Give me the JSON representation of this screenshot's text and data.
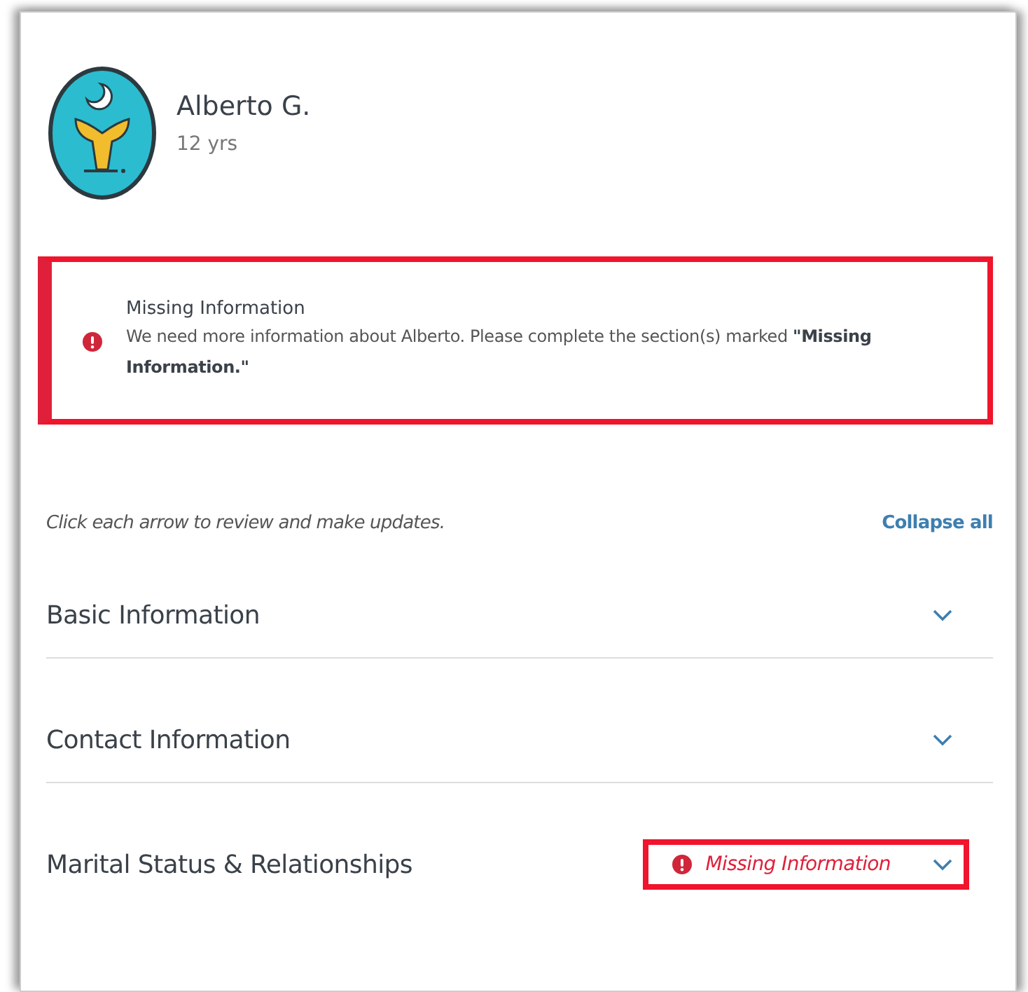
{
  "profile": {
    "name": "Alberto G.",
    "age": "12 yrs"
  },
  "alert": {
    "title": "Missing Information",
    "message": "We need more information about Alberto. Please complete the section(s) marked **\"Missing Information.\"**",
    "highlighted": true
  },
  "instructions": "Click each arrow to review and make updates.",
  "collapse_link": "Collapse all",
  "sections": [
    {
      "title": "Basic Information",
      "missing": false,
      "expanded": false
    },
    {
      "title": "Contact Information",
      "missing": false,
      "expanded": false
    },
    {
      "title": "Marital Status & Relationships",
      "missing": true,
      "missing_label": "Missing Information",
      "highlighted": true,
      "expanded": false
    }
  ]
}
